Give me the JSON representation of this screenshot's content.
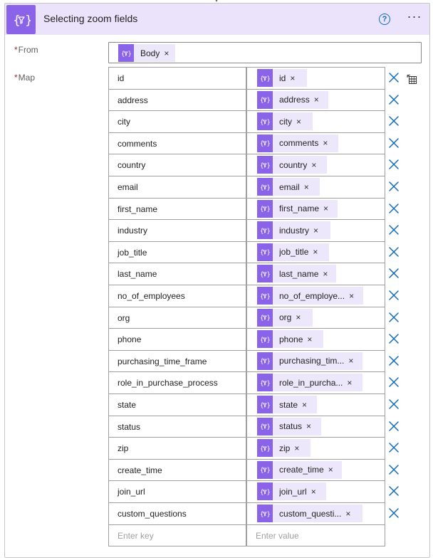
{
  "action": {
    "title": "Selecting zoom fields",
    "icon": "data-operations-icon",
    "accent": "#8a63e8",
    "header_bg": "#eae3fb"
  },
  "header": {
    "help_icon": "help-icon",
    "help_glyph": "?",
    "more_icon": "more-options-icon",
    "more_glyph": "···"
  },
  "from": {
    "required_mark": "*",
    "label": "From",
    "token": {
      "label": "Body",
      "remove": "×"
    }
  },
  "map": {
    "required_mark": "*",
    "label": "Map",
    "rows": [
      {
        "key": "id",
        "value": "id"
      },
      {
        "key": "address",
        "value": "address"
      },
      {
        "key": "city",
        "value": "city"
      },
      {
        "key": "comments",
        "value": "comments"
      },
      {
        "key": "country",
        "value": "country"
      },
      {
        "key": "email",
        "value": "email"
      },
      {
        "key": "first_name",
        "value": "first_name"
      },
      {
        "key": "industry",
        "value": "industry"
      },
      {
        "key": "job_title",
        "value": "job_title"
      },
      {
        "key": "last_name",
        "value": "last_name"
      },
      {
        "key": "no_of_employees",
        "value": "no_of_employe..."
      },
      {
        "key": "org",
        "value": "org"
      },
      {
        "key": "phone",
        "value": "phone"
      },
      {
        "key": "purchasing_time_frame",
        "value": "purchasing_tim..."
      },
      {
        "key": "role_in_purchase_process",
        "value": "role_in_purcha..."
      },
      {
        "key": "state",
        "value": "state"
      },
      {
        "key": "status",
        "value": "status"
      },
      {
        "key": "zip",
        "value": "zip"
      },
      {
        "key": "create_time",
        "value": "create_time"
      },
      {
        "key": "join_url",
        "value": "join_url"
      },
      {
        "key": "custom_questions",
        "value": "custom_questi..."
      }
    ],
    "token_remove": "×",
    "key_placeholder": "Enter key",
    "value_placeholder": "Enter value",
    "switch_mode_icon": "switch-to-text-mode-icon"
  }
}
